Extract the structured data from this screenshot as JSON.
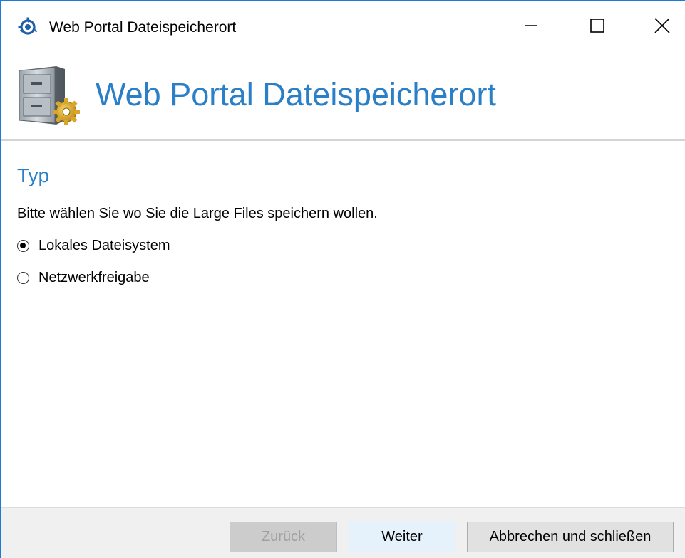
{
  "window": {
    "title": "Web Portal Dateispeicherort",
    "app_icon": "refresh-gear-icon",
    "controls": {
      "minimize_icon": "minimize-icon",
      "maximize_icon": "maximize-icon",
      "close_icon": "close-icon"
    }
  },
  "header": {
    "title": "Web Portal Dateispeicherort",
    "icon": "file-cabinet-gear-icon"
  },
  "content": {
    "section_title": "Typ",
    "instruction": "Bitte wählen Sie wo Sie die Large Files speichern wollen.",
    "options": [
      {
        "label": "Lokales Dateisystem",
        "selected": true
      },
      {
        "label": "Netzwerkfreigabe",
        "selected": false
      }
    ]
  },
  "footer": {
    "back_label": "Zurück",
    "back_enabled": false,
    "next_label": "Weiter",
    "cancel_label": "Abbrechen und schließen"
  },
  "colors": {
    "accent": "#2a7fc6",
    "window_border": "#1d7bd7",
    "footer_bg": "#f0f0f0"
  }
}
